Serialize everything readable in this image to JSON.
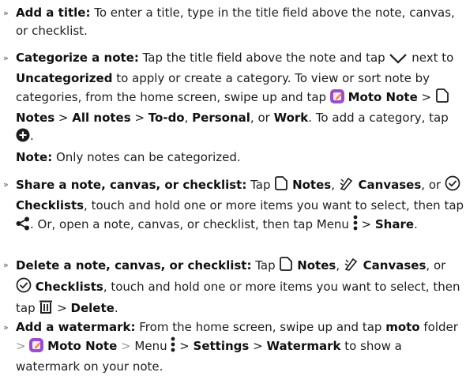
{
  "bullet": "»",
  "sep": ">",
  "items": {
    "title": {
      "lead": "Add a title:",
      "text": " To enter a title, type in the title field above the note, canvas, or checklist."
    },
    "categorize": {
      "lead": "Categorize a note:",
      "t1": " Tap the title field above the note and tap ",
      "t2": " next to ",
      "uncategorized": "Uncategorized",
      "t3": " to apply or create a category. To view or sort note by categories, from the home screen, swipe up and tap ",
      "moto_note": "Moto Note",
      "notes": "Notes",
      "all_notes": "All notes",
      "todo": "To-do",
      "personal": "Personal",
      "comma": ", ",
      "or": ", or ",
      "work": "Work",
      "t4": ". To add a category, tap ",
      "end": "."
    },
    "note": {
      "lead": "Note:",
      "text": " Only notes can be categorized."
    },
    "share": {
      "lead": "Share a note, canvas, or checklist:",
      "tap": " Tap ",
      "notes": "Notes",
      "canvases": "Canvases",
      "checklists": "Checklists",
      "comma": ", ",
      "or": ", or ",
      "t1": ", touch and hold one or more items you want to select, then tap ",
      "t2": ". Or, open a note, canvas, or checklist, then tap Menu ",
      "share": "Share",
      "end": "."
    },
    "delete": {
      "lead": "Delete a note, canvas, or checklist:",
      "tap": " Tap ",
      "notes": "Notes",
      "canvases": "Canvases",
      "checklists": "Checklists",
      "comma": ", ",
      "or": ", or ",
      "t1": ", touch and hold one or more items you want to select, then tap ",
      "delete": "Delete",
      "end": "."
    },
    "watermark": {
      "lead": "Add a watermark:",
      "t1": " From the home screen, swipe up and tap ",
      "moto": "moto",
      "folder": " folder ",
      "moto_note": "Moto Note",
      "menu": " Menu ",
      "settings": "Settings",
      "wm": "Watermark",
      "t2": " to show a watermark on your note."
    }
  },
  "colors": {
    "text": "#1d1d1d",
    "app_icon": "#9a4fc9",
    "app_icon_accent": "#f28b3c",
    "separator_gray": "#9a9a9a"
  },
  "icons": [
    "chevron-down-icon",
    "moto-note-app-icon",
    "notes-icon",
    "add-circle-icon",
    "canvases-icon",
    "checklists-icon",
    "share-icon",
    "menu-dots-icon",
    "trash-icon"
  ]
}
